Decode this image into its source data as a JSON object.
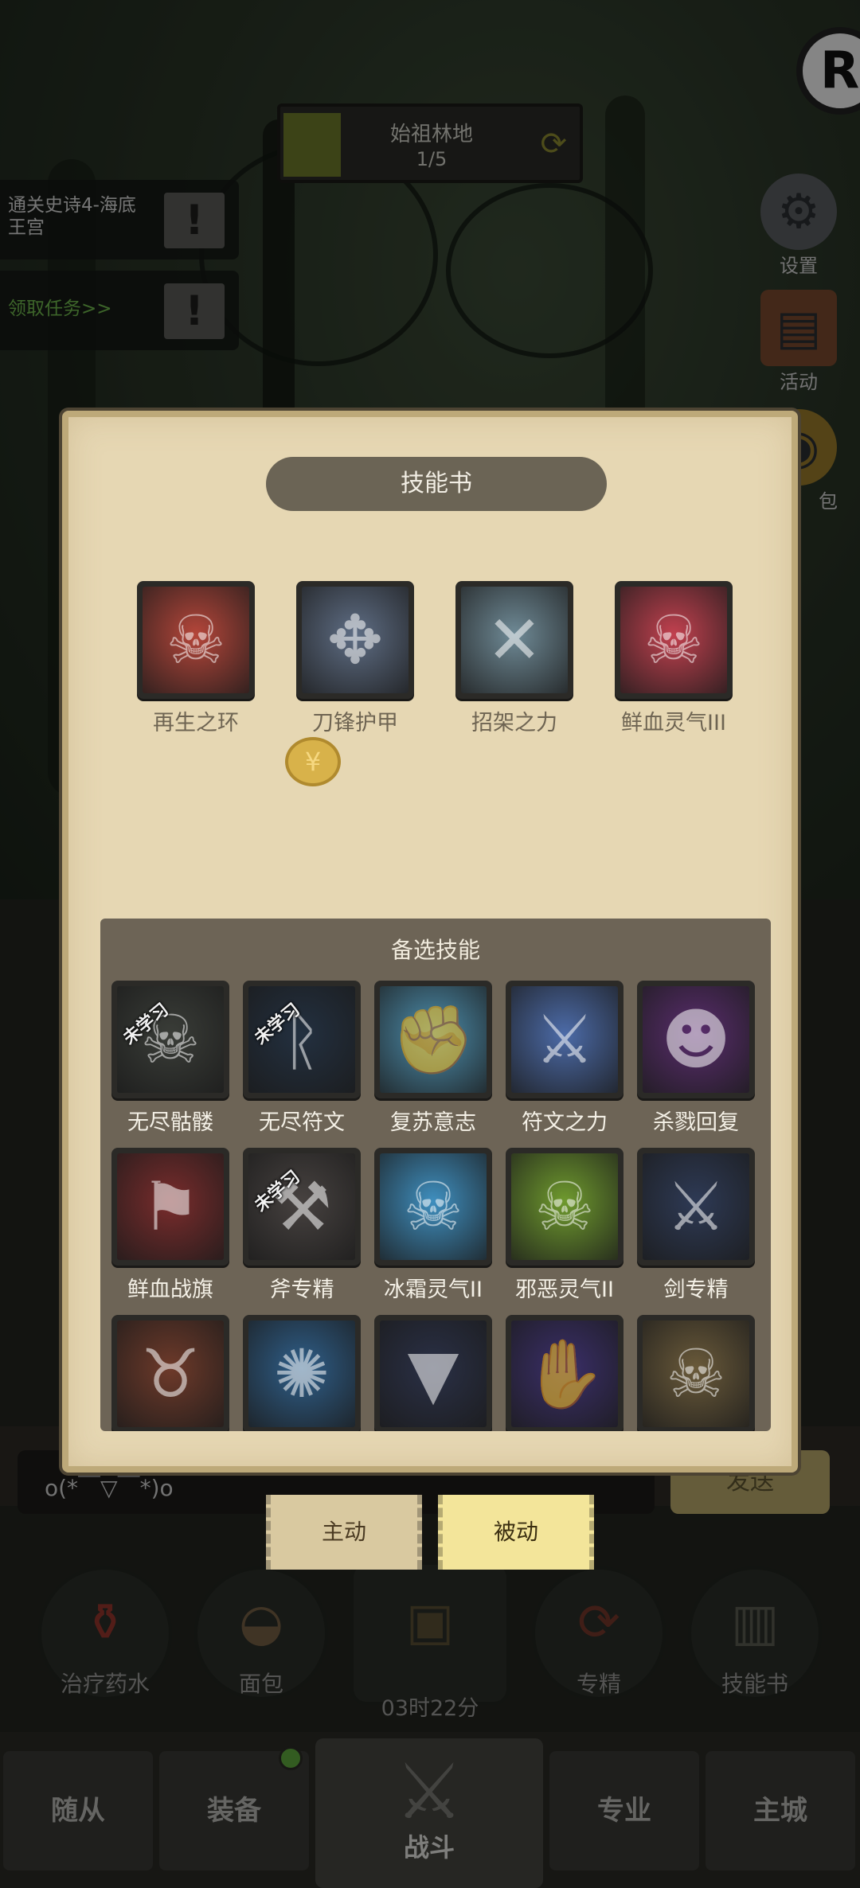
{
  "stage": {
    "name": "始祖林地",
    "progress": "1/5"
  },
  "quests": [
    {
      "text": "通关史诗4-海底王宫",
      "mark": "!"
    },
    {
      "text": "领取任务>>",
      "mark": "!"
    }
  ],
  "side_menu": [
    {
      "label": "设置",
      "icon": "gear-icon"
    },
    {
      "label": "活动",
      "icon": "scroll-icon"
    },
    {
      "label": "包",
      "icon": "bag-icon"
    }
  ],
  "chat": {
    "text": "o(*￣▽￣*)o",
    "send_label": "发送"
  },
  "mode_tabs": [
    {
      "label": "主动",
      "active": false
    },
    {
      "label": "被动",
      "active": true
    }
  ],
  "actions": [
    {
      "label": "治疗药水",
      "icon": "potion-icon"
    },
    {
      "label": "面包",
      "icon": "bread-icon"
    },
    {
      "label": "03时22分",
      "icon": "chest-icon"
    },
    {
      "label": "专精",
      "icon": "specialization-icon"
    },
    {
      "label": "技能书",
      "icon": "skillbook-icon"
    }
  ],
  "bottom_nav": [
    {
      "label": "随从"
    },
    {
      "label": "装备"
    },
    {
      "label": "战斗"
    },
    {
      "label": "专业"
    },
    {
      "label": "主城"
    }
  ],
  "modal": {
    "title": "技能书",
    "equipped": [
      {
        "name": "再生之环",
        "icon": "red-skull-icon",
        "color": "#b5463a"
      },
      {
        "name": "刀锋护甲",
        "icon": "blade-armor-icon",
        "color": "#5f6e85"
      },
      {
        "name": "招架之力",
        "icon": "crossed-blades-icon",
        "color": "#6f8a96"
      },
      {
        "name": "鲜血灵气III",
        "icon": "blood-skull-icon",
        "color": "#c2414f"
      }
    ],
    "alt_title": "备选技能",
    "unlearned_label": "未学习",
    "alternates": [
      {
        "name": "无尽骷髅",
        "icon": "skeleton-icon",
        "color": "#3a3d38",
        "unlearned": true
      },
      {
        "name": "无尽符文",
        "icon": "rune-icon",
        "color": "#233040",
        "unlearned": true
      },
      {
        "name": "复苏意志",
        "icon": "fist-icon",
        "color": "#4d8fae",
        "unlearned": false
      },
      {
        "name": "符文之力",
        "icon": "rune-sword-icon",
        "color": "#4c6ba8",
        "unlearned": false
      },
      {
        "name": "杀戮回复",
        "icon": "demon-face-icon",
        "color": "#5a2d6e",
        "unlearned": false
      },
      {
        "name": "鲜血战旗",
        "icon": "blood-banner-icon",
        "color": "#7a2c2c",
        "unlearned": false
      },
      {
        "name": "斧专精",
        "icon": "axe-icon",
        "color": "#474240",
        "unlearned": true
      },
      {
        "name": "冰霜灵气II",
        "icon": "frost-skull-icon",
        "color": "#3f8fbf",
        "unlearned": false
      },
      {
        "name": "邪恶灵气II",
        "icon": "unholy-skull-icon",
        "color": "#6f9a2e",
        "unlearned": false
      },
      {
        "name": "剑专精",
        "icon": "sword-icon",
        "color": "#2e3a55",
        "unlearned": false
      },
      {
        "name": "",
        "icon": "horned-demon-icon",
        "color": "#6e3a2a",
        "unlearned": false
      },
      {
        "name": "",
        "icon": "frost-shield-icon",
        "color": "#2f5f8a",
        "unlearned": false
      },
      {
        "name": "",
        "icon": "fanged-maw-icon",
        "color": "#2a3046",
        "unlearned": false
      },
      {
        "name": "",
        "icon": "claw-icon",
        "color": "#3b2f6a",
        "unlearned": false
      },
      {
        "name": "",
        "icon": "bone-skull-icon",
        "color": "#6a5a3a",
        "unlearned": false
      }
    ]
  }
}
